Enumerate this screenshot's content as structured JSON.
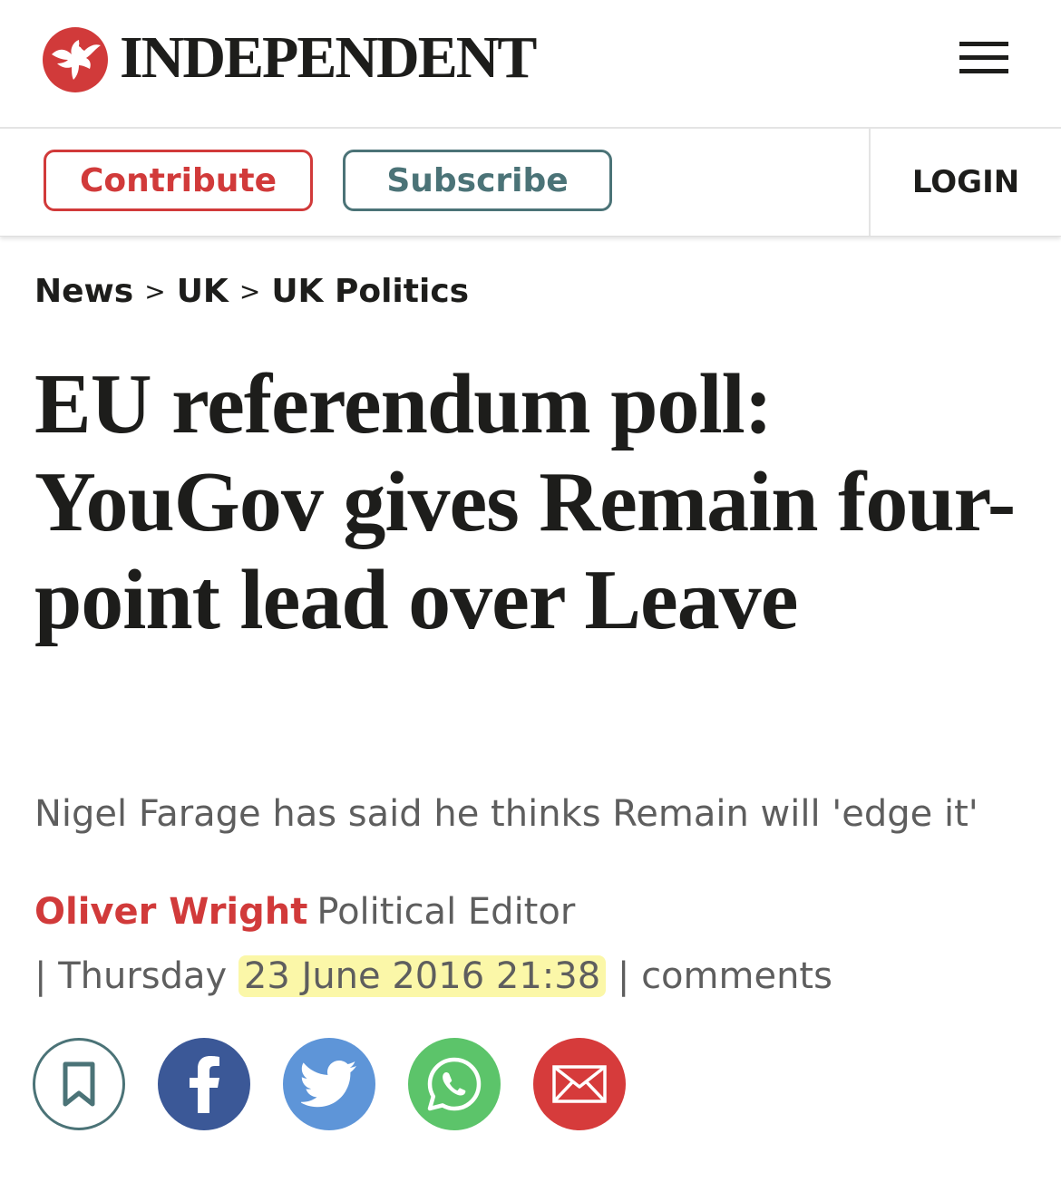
{
  "masthead": {
    "logo_text": "INDEPENDENT",
    "logo_icon": "eagle-logo-icon",
    "menu_icon": "hamburger-menu-icon"
  },
  "actions": {
    "contribute_label": "Contribute",
    "subscribe_label": "Subscribe",
    "login_label": "LOGIN"
  },
  "breadcrumb": [
    {
      "label": "News"
    },
    {
      "label": "UK"
    },
    {
      "label": "UK Politics"
    }
  ],
  "breadcrumb_separator": ">",
  "article": {
    "headline": "EU referendum poll: YouGov gives Remain four-point lead over Leave",
    "standfirst": "Nigel Farage has said he thinks Remain will 'edge it'",
    "author": "Oliver Wright",
    "author_role": "Political Editor",
    "day": "Thursday",
    "date_time": "23 June 2016 21:38",
    "comments_label": "comments"
  },
  "share": [
    {
      "name": "bookmark-icon"
    },
    {
      "name": "facebook-icon"
    },
    {
      "name": "twitter-icon"
    },
    {
      "name": "whatsapp-icon"
    },
    {
      "name": "email-icon"
    }
  ],
  "colors": {
    "brand_red": "#d13a3a",
    "subscribe_teal": "#4b7377",
    "facebook": "#3b5897",
    "twitter": "#5e95d8",
    "whatsapp": "#5cc46a",
    "email": "#d63b3b",
    "date_highlight": "#fbf7a8"
  }
}
